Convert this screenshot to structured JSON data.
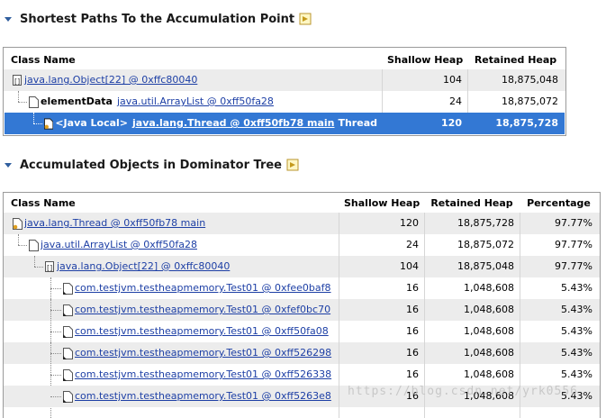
{
  "section1": {
    "title": "Shortest Paths To the Accumulation Point",
    "columns": {
      "name": "Class Name",
      "shallow": "Shallow Heap",
      "retained": "Retained Heap"
    },
    "rows": [
      {
        "prefix": "",
        "link": "java.lang.Object[22] @ 0xffc80040",
        "suffix": "",
        "shallow": "104",
        "retained": "18,875,048"
      },
      {
        "prefix": "elementData",
        "link": "java.util.ArrayList @ 0xff50fa28",
        "suffix": "",
        "shallow": "24",
        "retained": "18,875,072"
      },
      {
        "prefix": "<Java Local>",
        "link": "java.lang.Thread @ 0xff50fb78 main",
        "suffix": "Thread",
        "shallow": "120",
        "retained": "18,875,728"
      }
    ]
  },
  "section2": {
    "title": "Accumulated Objects in Dominator Tree",
    "columns": {
      "name": "Class Name",
      "shallow": "Shallow Heap",
      "retained": "Retained Heap",
      "pct": "Percentage"
    },
    "rows": [
      {
        "link": "java.lang.Thread @ 0xff50fb78 main",
        "shallow": "120",
        "retained": "18,875,728",
        "pct": "97.77%"
      },
      {
        "link": "java.util.ArrayList @ 0xff50fa28",
        "shallow": "24",
        "retained": "18,875,072",
        "pct": "97.77%"
      },
      {
        "link": "java.lang.Object[22] @ 0xffc80040",
        "shallow": "104",
        "retained": "18,875,048",
        "pct": "97.77%"
      },
      {
        "link": "com.testjvm.testheapmemory.Test01 @ 0xfee0baf8",
        "shallow": "16",
        "retained": "1,048,608",
        "pct": "5.43%"
      },
      {
        "link": "com.testjvm.testheapmemory.Test01 @ 0xfef0bc70",
        "shallow": "16",
        "retained": "1,048,608",
        "pct": "5.43%"
      },
      {
        "link": "com.testjvm.testheapmemory.Test01 @ 0xff50fa08",
        "shallow": "16",
        "retained": "1,048,608",
        "pct": "5.43%"
      },
      {
        "link": "com.testjvm.testheapmemory.Test01 @ 0xff526298",
        "shallow": "16",
        "retained": "1,048,608",
        "pct": "5.43%"
      },
      {
        "link": "com.testjvm.testheapmemory.Test01 @ 0xff526338",
        "shallow": "16",
        "retained": "1,048,608",
        "pct": "5.43%"
      },
      {
        "link": "com.testjvm.testheapmemory.Test01 @ 0xff5263e8",
        "shallow": "16",
        "retained": "1,048,608",
        "pct": "5.43%"
      }
    ]
  },
  "watermark": "https://blog.csdn.net/yrk0556",
  "colors": {
    "selection": "#3378d4",
    "link": "#1d3fa5",
    "alt_row": "#ececec"
  },
  "icons": {
    "collapse": "triangle-down-icon",
    "info": "info-page-icon",
    "object": "object-icon",
    "array": "array-icon",
    "thread": "thread-icon"
  }
}
